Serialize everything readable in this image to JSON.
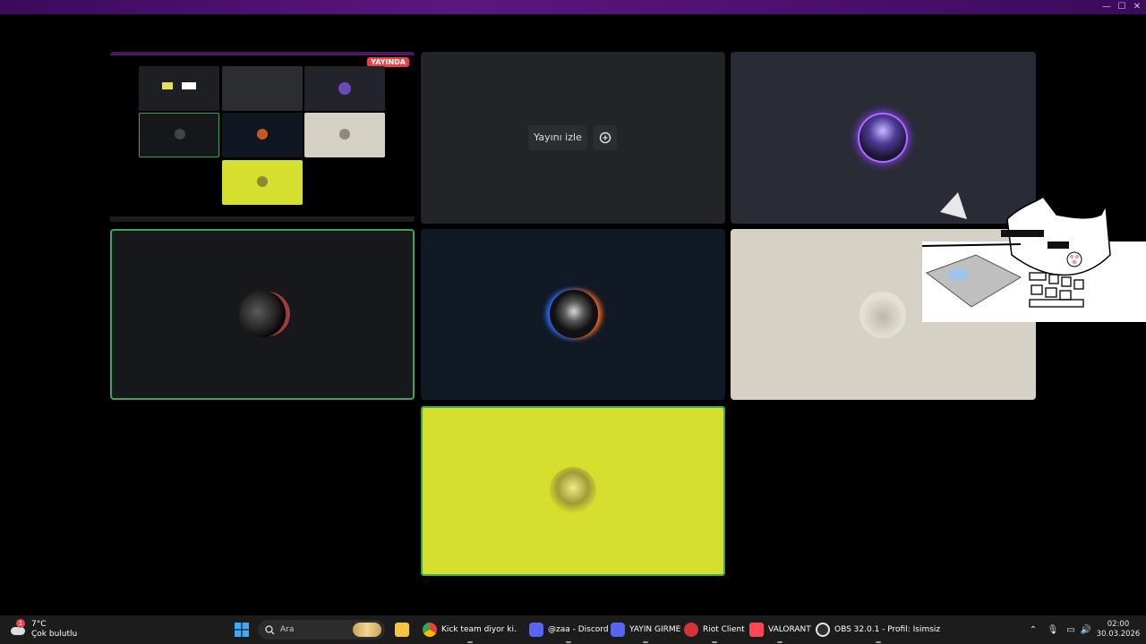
{
  "stage": {
    "live_badge": "YAYINDA",
    "watch_stream_label": "Yayını izle"
  },
  "taskbar": {
    "weather": {
      "temp": "7°C",
      "desc": "Çok bulutlu",
      "badge": "1"
    },
    "search_placeholder": "Ara",
    "apps": [
      {
        "label": "Kick team diyor ki... - Go"
      },
      {
        "label": "@zaa - Discord"
      },
      {
        "label": "YAYIN GİRME"
      },
      {
        "label": "Riot Client"
      },
      {
        "label": "VALORANT"
      },
      {
        "label": "OBS 32.0.1 - Profil: İsimsiz"
      }
    ],
    "clock": {
      "time": "02:00",
      "date": "30.03.2026"
    }
  },
  "colors": {
    "accent_green": "#3ba55d",
    "live_red": "#ed4245",
    "discord_blurple": "#5865f2",
    "yellow_tile": "#d6df2e"
  }
}
